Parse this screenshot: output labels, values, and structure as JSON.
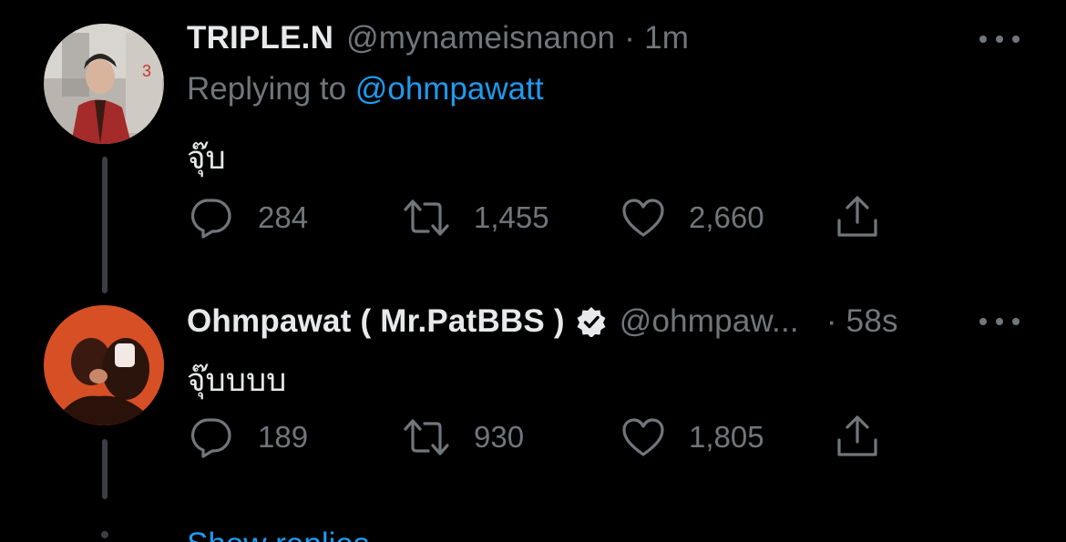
{
  "tweets": [
    {
      "display_name": "TRIPLE.N",
      "handle": "@mynameisnanon",
      "separator": "·",
      "time": "1m",
      "replying_prefix": "Replying to",
      "replying_to": "@ohmpawatt",
      "text": "จุ๊บ",
      "replies": "284",
      "retweets": "1,455",
      "likes": "2,660"
    },
    {
      "display_name": "Ohmpawat ( Mr.PatBBS )",
      "verified": true,
      "handle": "@ohmpaw...",
      "separator": "·",
      "time": "58s",
      "text": "จุ๊บบบบ",
      "replies": "189",
      "retweets": "930",
      "likes": "1,805"
    }
  ],
  "show_replies_label": "Show replies",
  "icons": {
    "reply": "reply-icon",
    "retweet": "retweet-icon",
    "like": "heart-icon",
    "share": "share-icon",
    "more": "more-icon",
    "verified": "verified-icon"
  },
  "colors": {
    "background": "#000000",
    "text": "#e7e9ea",
    "muted": "#71767b",
    "accent": "#1d9bf0"
  }
}
